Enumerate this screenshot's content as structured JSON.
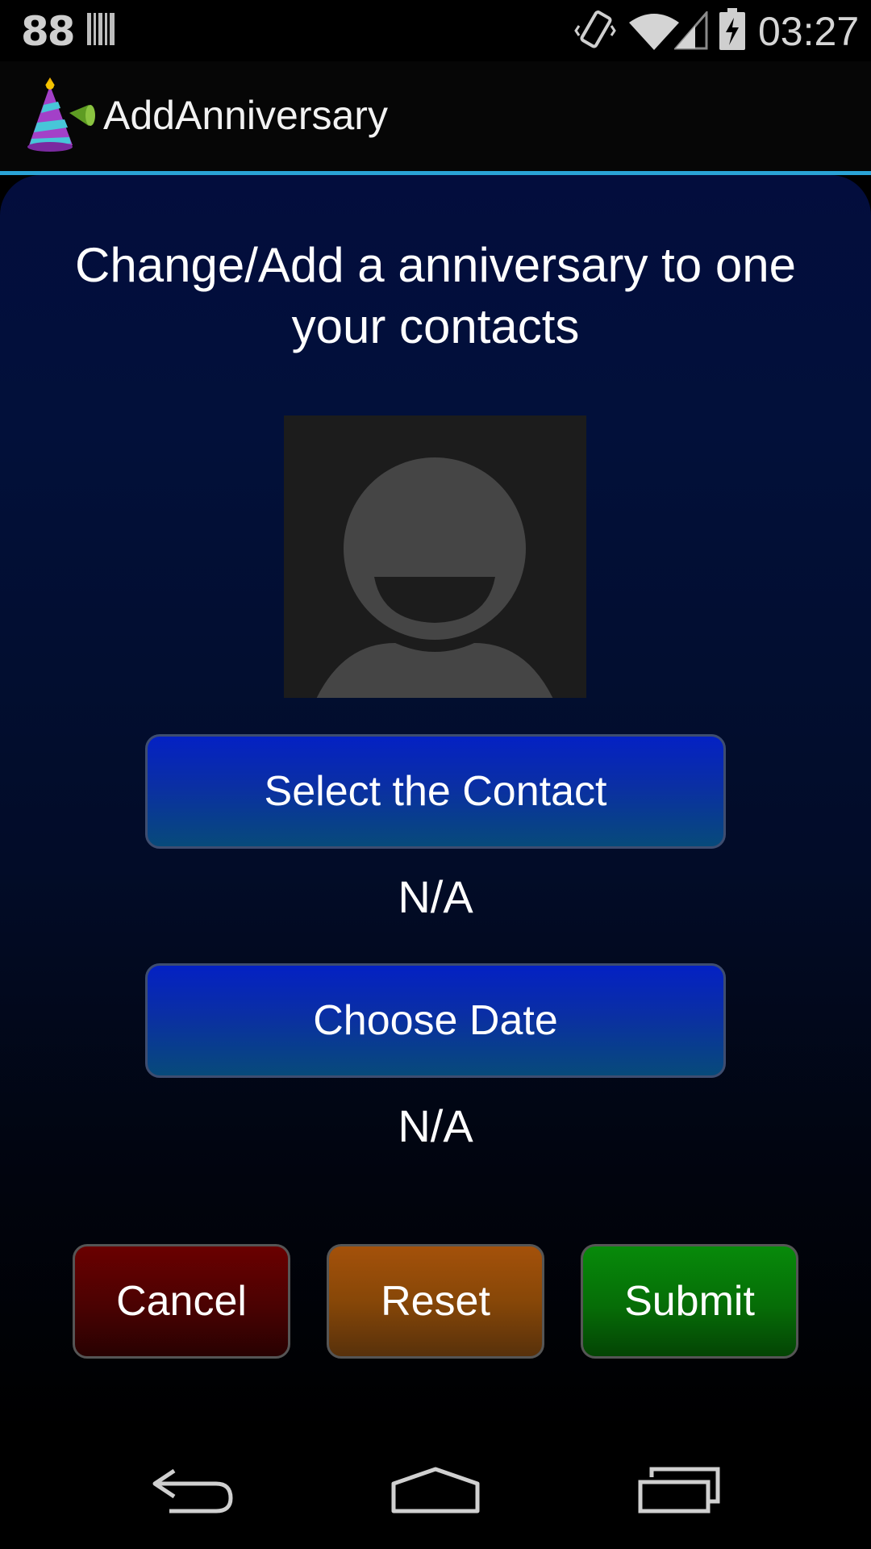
{
  "status_bar": {
    "notification_count": "88",
    "notification_icon": "barcode-icon",
    "clock": "03:27",
    "icons": [
      "vibrate-icon",
      "wifi-icon",
      "signal-icon",
      "battery-charging-icon"
    ]
  },
  "action_bar": {
    "title": "AddAnniversary",
    "icon": "party-hat-icon"
  },
  "main": {
    "headline": "Change/Add a anniversary to one your contacts",
    "photo_icon": "contact-placeholder-icon",
    "select_contact_label": "Select the Contact",
    "contact_value": "N/A",
    "choose_date_label": "Choose Date",
    "date_value": "N/A",
    "cancel_label": "Cancel",
    "reset_label": "Reset",
    "submit_label": "Submit"
  },
  "nav_bar": {
    "icons": [
      "back-icon",
      "home-icon",
      "recents-icon"
    ]
  },
  "colors": {
    "accent_divider": "#2aa3d6",
    "primary_button": "#0421c4",
    "cancel_button": "#6a0000",
    "reset_button": "#a4510a",
    "submit_button": "#078a0a"
  }
}
